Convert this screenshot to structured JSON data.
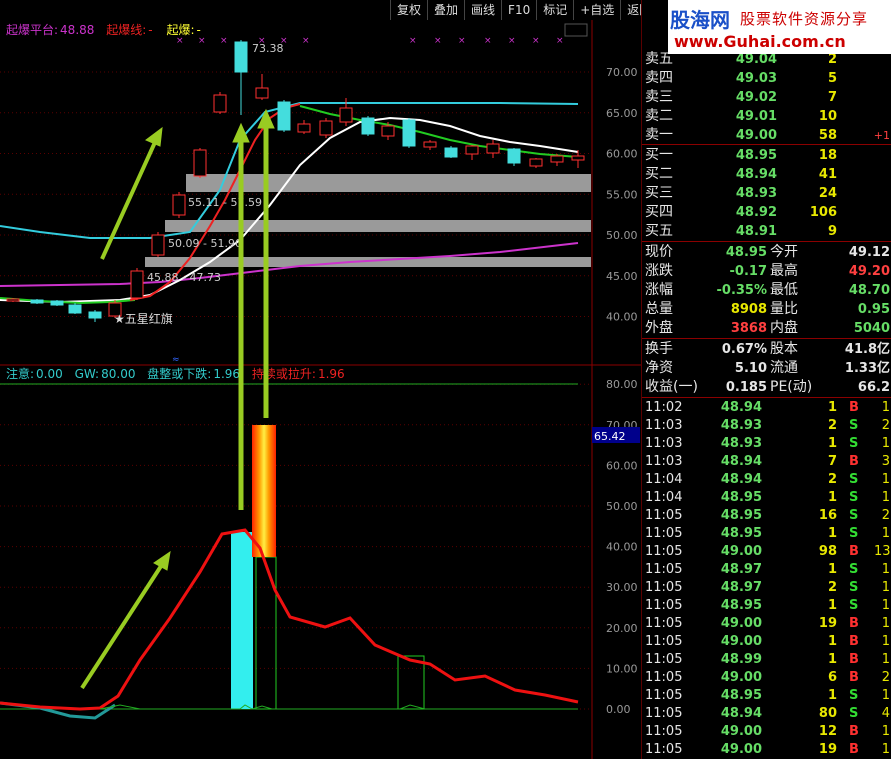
{
  "toolbar": {
    "items": [
      "复权",
      "叠加",
      "画线",
      "F10",
      "标记",
      "+自选",
      "返回"
    ]
  },
  "indicator_top": {
    "label1": "起爆平台:",
    "value1": "48.88",
    "label2": "起爆线:",
    "value2": "-",
    "label3": "起爆:",
    "value3": "-"
  },
  "indicator_bottom": {
    "l1": "注意:",
    "v1": "0.00",
    "l2": "GW:",
    "v2": "80.00",
    "l3": "盘整或下跌:",
    "v3": "1.96",
    "l4": "持续或拉升:",
    "v4": "1.96"
  },
  "annotations": {
    "high": "73.38",
    "range1": "55.11 - 57.59",
    "range2": "50.09 - 51.90",
    "range3": "45.88 - 47.73",
    "star": "★五星红旗"
  },
  "price_axis": [
    "70.00",
    "65.00",
    "60.00",
    "55.00",
    "50.00",
    "45.00",
    "40.00"
  ],
  "osc_axis": [
    "80.00",
    "70.00",
    "60.00",
    "50.00",
    "40.00",
    "30.00",
    "20.00",
    "10.00",
    "0.00"
  ],
  "osc_current": "65.42",
  "logo": {
    "title": "股海网",
    "sub": "股票软件资源分享",
    "url": "www.Guhai.com.cn"
  },
  "orderbook": {
    "sells": [
      {
        "label": "卖五",
        "price": "49.04",
        "vol": "2",
        "chg": ""
      },
      {
        "label": "卖四",
        "price": "49.03",
        "vol": "5",
        "chg": ""
      },
      {
        "label": "卖三",
        "price": "49.02",
        "vol": "7",
        "chg": ""
      },
      {
        "label": "卖二",
        "price": "49.01",
        "vol": "10",
        "chg": ""
      },
      {
        "label": "卖一",
        "price": "49.00",
        "vol": "58",
        "chg": "+1"
      }
    ],
    "buys": [
      {
        "label": "买一",
        "price": "48.95",
        "vol": "18"
      },
      {
        "label": "买二",
        "price": "48.94",
        "vol": "41"
      },
      {
        "label": "买三",
        "price": "48.93",
        "vol": "24"
      },
      {
        "label": "买四",
        "price": "48.92",
        "vol": "106"
      },
      {
        "label": "买五",
        "price": "48.91",
        "vol": "9"
      }
    ]
  },
  "quote": {
    "rows": [
      {
        "l1": "现价",
        "v1": "48.95",
        "c1": "#66dd66",
        "l2": "今开",
        "v2": "49.12",
        "c2": "#e6e6e6"
      },
      {
        "l1": "涨跌",
        "v1": "-0.17",
        "c1": "#66dd66",
        "l2": "最高",
        "v2": "49.20",
        "c2": "#ff4040"
      },
      {
        "l1": "涨幅",
        "v1": "-0.35%",
        "c1": "#66dd66",
        "l2": "最低",
        "v2": "48.70",
        "c2": "#66dd66"
      },
      {
        "l1": "总量",
        "v1": "8908",
        "c1": "#e8e800",
        "l2": "量比",
        "v2": "0.95",
        "c2": "#66dd66"
      },
      {
        "l1": "外盘",
        "v1": "3868",
        "c1": "#ff4040",
        "l2": "内盘",
        "v2": "5040",
        "c2": "#66dd66"
      }
    ],
    "rows2": [
      {
        "l1": "换手",
        "v1": "0.67%",
        "l2": "股本",
        "v2": "41.8亿"
      },
      {
        "l1": "净资",
        "v1": "5.10",
        "l2": "流通",
        "v2": "1.33亿"
      },
      {
        "l1": "收益(一)",
        "v1": "0.185",
        "l2": "PE(动)",
        "v2": "66.2"
      }
    ]
  },
  "ticks": [
    {
      "t": "11:02",
      "p": "48.94",
      "v": "1",
      "bs": "B",
      "n": "1"
    },
    {
      "t": "11:03",
      "p": "48.93",
      "v": "2",
      "bs": "S",
      "n": "2"
    },
    {
      "t": "11:03",
      "p": "48.93",
      "v": "1",
      "bs": "S",
      "n": "1"
    },
    {
      "t": "11:03",
      "p": "48.94",
      "v": "7",
      "bs": "B",
      "n": "3"
    },
    {
      "t": "11:04",
      "p": "48.94",
      "v": "2",
      "bs": "S",
      "n": "1"
    },
    {
      "t": "11:04",
      "p": "48.95",
      "v": "1",
      "bs": "S",
      "n": "1"
    },
    {
      "t": "11:05",
      "p": "48.95",
      "v": "16",
      "bs": "S",
      "n": "2"
    },
    {
      "t": "11:05",
      "p": "48.95",
      "v": "1",
      "bs": "S",
      "n": "1"
    },
    {
      "t": "11:05",
      "p": "49.00",
      "v": "98",
      "bs": "B",
      "n": "13"
    },
    {
      "t": "11:05",
      "p": "48.97",
      "v": "1",
      "bs": "S",
      "n": "1"
    },
    {
      "t": "11:05",
      "p": "48.97",
      "v": "2",
      "bs": "S",
      "n": "1"
    },
    {
      "t": "11:05",
      "p": "48.95",
      "v": "1",
      "bs": "S",
      "n": "1"
    },
    {
      "t": "11:05",
      "p": "49.00",
      "v": "19",
      "bs": "B",
      "n": "1"
    },
    {
      "t": "11:05",
      "p": "49.00",
      "v": "1",
      "bs": "B",
      "n": "1"
    },
    {
      "t": "11:05",
      "p": "48.99",
      "v": "1",
      "bs": "B",
      "n": "1"
    },
    {
      "t": "11:05",
      "p": "49.00",
      "v": "6",
      "bs": "B",
      "n": "2"
    },
    {
      "t": "11:05",
      "p": "48.95",
      "v": "1",
      "bs": "S",
      "n": "1"
    },
    {
      "t": "11:05",
      "p": "48.94",
      "v": "80",
      "bs": "S",
      "n": "4"
    },
    {
      "t": "11:05",
      "p": "49.00",
      "v": "12",
      "bs": "B",
      "n": "1"
    },
    {
      "t": "11:05",
      "p": "49.00",
      "v": "19",
      "bs": "B",
      "n": "1"
    }
  ],
  "colors": {
    "up": "#ff3030",
    "down": "#00ffff",
    "buy": "#ff3030",
    "sell": "#33dd33",
    "arrow": "#99cc22"
  }
}
